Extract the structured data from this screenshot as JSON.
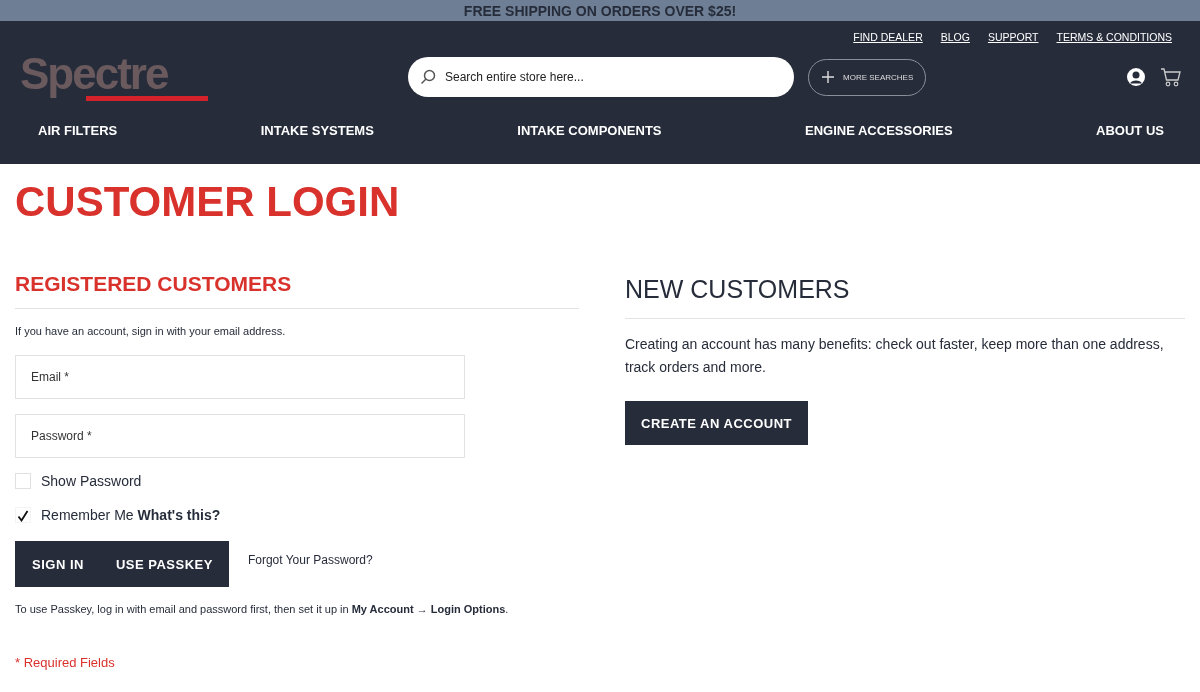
{
  "promo_bar": {
    "text": "FREE SHIPPING ON ORDERS OVER $25!"
  },
  "header": {
    "top_links": [
      "FIND DEALER",
      "BLOG",
      "SUPPORT",
      "TERMS & CONDITIONS"
    ],
    "logo": "Spectre",
    "search": {
      "placeholder": "Search entire store here..."
    },
    "more_searches": "MORE SEARCHES"
  },
  "nav": [
    "AIR FILTERS",
    "INTAKE SYSTEMS",
    "INTAKE COMPONENTS",
    "ENGINE ACCESSORIES",
    "ABOUT US"
  ],
  "page_title": "CUSTOMER LOGIN",
  "registered": {
    "heading": "REGISTERED CUSTOMERS",
    "intro": "If you have an account, sign in with your email address.",
    "fields": [
      {
        "placeholder": "Email *"
      },
      {
        "placeholder": "Password *"
      }
    ],
    "checkboxes": [
      {
        "label": "Show Password",
        "checked": false
      },
      {
        "label": "Remember Me",
        "checked": true,
        "link": "What's this?"
      }
    ],
    "buttons": [
      "SIGN IN",
      "USE PASSKEY"
    ],
    "forgot": "Forgot Your Password?",
    "passkey_note": "To use Passkey, log in with email and password first, then set it up in **My Account → Login Options**.",
    "required": "* Required Fields"
  },
  "new_customers": {
    "heading": "NEW CUSTOMERS",
    "text": "Creating an account has many benefits: check out faster, keep more than one address, track orders and more.",
    "button": "CREATE AN ACCOUNT"
  }
}
